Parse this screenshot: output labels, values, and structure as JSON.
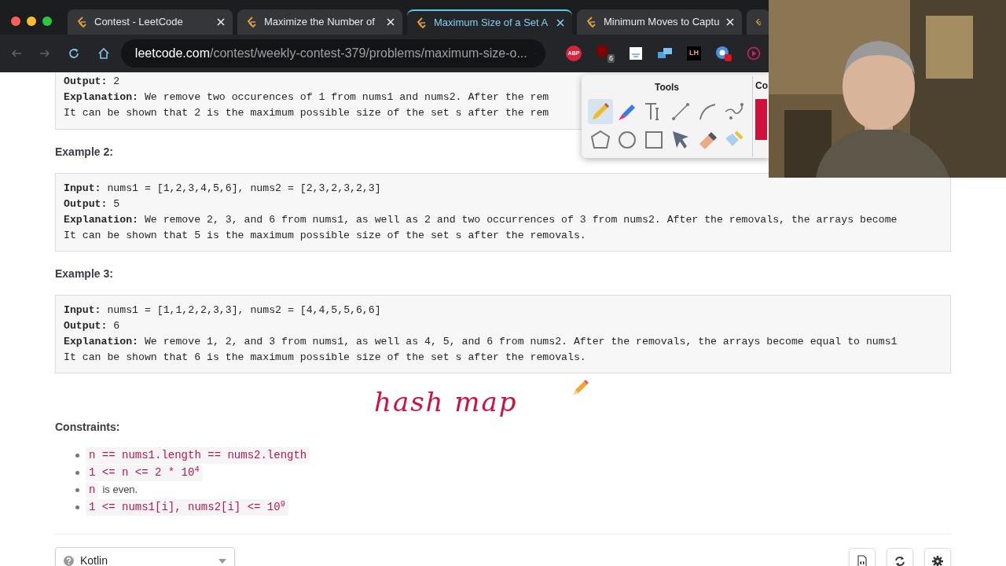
{
  "browser": {
    "tabs": [
      {
        "title": "Contest - LeetCode",
        "selected": false
      },
      {
        "title": "Maximize the Number of",
        "selected": false
      },
      {
        "title": "Maximum Size of a Set A",
        "selected": true
      },
      {
        "title": "Minimum Moves to Captu",
        "selected": false
      },
      {
        "selected": false
      }
    ],
    "url_host": "leetcode.com",
    "url_path": "/contest/weekly-contest-379/problems/maximum-size-o...",
    "extensions": [
      {
        "kind": "abp",
        "text": "ABP"
      },
      {
        "kind": "badge",
        "text": "6"
      },
      {
        "kind": "doc"
      },
      {
        "kind": "layers"
      },
      {
        "kind": "lh",
        "text": "LH"
      },
      {
        "kind": "chrome"
      },
      {
        "kind": "play"
      }
    ]
  },
  "examples": [
    {
      "lines": [
        {
          "label": "Output:",
          "text": "2"
        },
        {
          "label": "Explanation:",
          "text": "We remove two occurences of 1 from nums1 and nums2. After the rem"
        },
        {
          "text": "It can be shown that 2 is the maximum possible size of the set s after the rem"
        }
      ]
    },
    {
      "title": "Example 2:",
      "lines": [
        {
          "label": "Input:",
          "text": "nums1 = [1,2,3,4,5,6], nums2 = [2,3,2,3,2,3]"
        },
        {
          "label": "Output:",
          "text": "5"
        },
        {
          "label": "Explanation:",
          "text": "We remove 2, 3, and 6 from nums1, as well as 2 and two occurrences of 3 from nums2. After the removals, the arrays become"
        },
        {
          "text": "It can be shown that 5 is the maximum possible size of the set s after the removals."
        }
      ]
    },
    {
      "title": "Example 3:",
      "lines": [
        {
          "label": "Input:",
          "text": "nums1 = [1,1,2,2,3,3], nums2 = [4,4,5,5,6,6]"
        },
        {
          "label": "Output:",
          "text": "6"
        },
        {
          "label": "Explanation:",
          "text": "We remove 1, 2, and 3 from nums1, as well as 4, 5, and 6 from nums2. After the removals, the arrays become equal to nums1"
        },
        {
          "text": "It can be shown that 6 is the maximum possible size of the set s after the removals."
        }
      ]
    }
  ],
  "annotation": "hash map",
  "constraints_title": "Constraints:",
  "constraints": [
    [
      {
        "kind": "code",
        "text": "n == nums1.length == nums2.length"
      }
    ],
    [
      {
        "kind": "code",
        "text": "1 <= n <= 2 * 10$^{4}$"
      }
    ],
    [
      {
        "kind": "code",
        "text": "n"
      },
      {
        "kind": "plain",
        "text": "is even."
      }
    ],
    [
      {
        "kind": "code",
        "text": "1 <= nums1[i], nums2[i] <= 10$^{9}$"
      }
    ]
  ],
  "tools_panel": {
    "title": "Tools",
    "tools": [
      {
        "kind": "pencil",
        "selected": true
      },
      {
        "kind": "marker",
        "selected": false
      },
      {
        "kind": "text",
        "selected": false
      },
      {
        "kind": "line",
        "selected": false
      },
      {
        "kind": "arc",
        "selected": false
      },
      {
        "kind": "curve",
        "selected": false
      },
      {
        "kind": "polygon",
        "selected": false
      },
      {
        "kind": "circle",
        "selected": false
      },
      {
        "kind": "rect",
        "selected": false
      },
      {
        "kind": "pointer",
        "selected": false
      },
      {
        "kind": "eraser",
        "selected": false
      },
      {
        "kind": "fill",
        "selected": false
      }
    ],
    "color_label": "Co",
    "color": "#d0103a"
  },
  "editor_bar": {
    "language": "Kotlin"
  }
}
